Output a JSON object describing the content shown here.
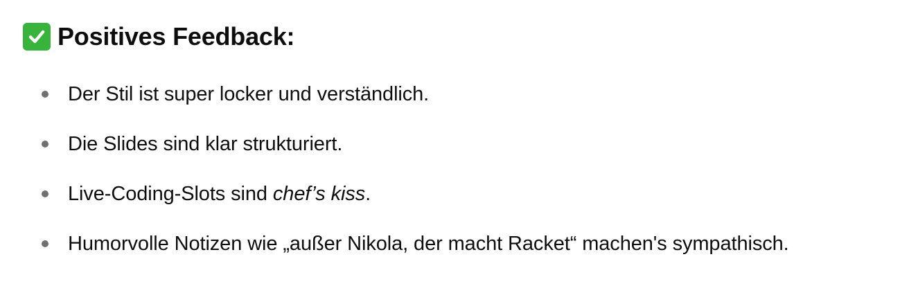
{
  "heading": {
    "icon": "check-mark-button-icon",
    "icon_color": "#38b43c",
    "title": "Positives Feedback:"
  },
  "items": [
    {
      "text": "Der Stil ist super locker und verständlich."
    },
    {
      "text": "Die Slides sind klar strukturiert."
    },
    {
      "before": "Live-Coding-Slots sind ",
      "emphasis": "chef’s kiss",
      "after": "."
    },
    {
      "text": "Humorvolle Notizen wie „außer Nikola, der macht Racket“ machen's sympathisch."
    }
  ]
}
